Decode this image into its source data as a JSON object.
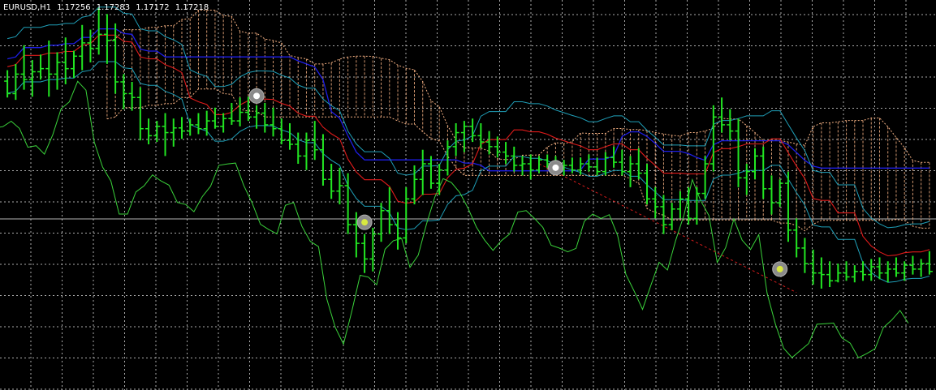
{
  "chart_header": {
    "symbol_timeframe": "EURUSD,H1",
    "open": "1.17256",
    "high": "1.17283",
    "low": "1.17172",
    "close": "1.17218"
  },
  "colors": {
    "background": "#000000",
    "grid": "#c8c8c8",
    "candles": "#22e622",
    "tenkan": "#e21b1b",
    "kijun": "#1e1ee6",
    "upper_band": "#1f9fb8",
    "chikou": "#3ad23a",
    "cloud": "#f5b183",
    "trendline": "#d21b1b",
    "marker": "#8a8a8a"
  },
  "chart_data": {
    "type": "candlestick",
    "symbol": "EURUSD",
    "timeframe": "H1",
    "ylim": [
      1.15,
      1.2
    ],
    "grid": true,
    "candles": [
      [
        1.1896,
        1.191,
        1.1875,
        1.188
      ],
      [
        1.188,
        1.1918,
        1.1872,
        1.1905
      ],
      [
        1.1905,
        1.1942,
        1.1885,
        1.1898
      ],
      [
        1.1898,
        1.1923,
        1.1876,
        1.1908
      ],
      [
        1.1908,
        1.193,
        1.1898,
        1.1912
      ],
      [
        1.1912,
        1.1948,
        1.1876,
        1.1905
      ],
      [
        1.1905,
        1.1933,
        1.1885,
        1.192
      ],
      [
        1.192,
        1.1952,
        1.1892,
        1.1912
      ],
      [
        1.1912,
        1.1935,
        1.19,
        1.1928
      ],
      [
        1.1928,
        1.1968,
        1.191,
        1.1945
      ],
      [
        1.1945,
        1.1962,
        1.192,
        1.1938
      ],
      [
        1.1938,
        1.199,
        1.193,
        1.1956
      ],
      [
        1.1956,
        1.1982,
        1.1918,
        1.1948
      ],
      [
        1.1948,
        1.197,
        1.188,
        1.1895
      ],
      [
        1.1895,
        1.1905,
        1.186,
        1.188
      ],
      [
        1.188,
        1.1895,
        1.1858,
        1.1875
      ],
      [
        1.1875,
        1.1888,
        1.182,
        1.1835
      ],
      [
        1.1835,
        1.1848,
        1.1815,
        1.1826
      ],
      [
        1.1826,
        1.1845,
        1.1818,
        1.1838
      ],
      [
        1.1838,
        1.1855,
        1.18,
        1.183
      ],
      [
        1.183,
        1.1848,
        1.1812,
        1.1836
      ],
      [
        1.1836,
        1.185,
        1.1822,
        1.1832
      ],
      [
        1.1832,
        1.1848,
        1.1826,
        1.184
      ],
      [
        1.184,
        1.1855,
        1.1828,
        1.1835
      ],
      [
        1.1835,
        1.1858,
        1.1826,
        1.1845
      ],
      [
        1.1845,
        1.1862,
        1.1835,
        1.1838
      ],
      [
        1.1838,
        1.1855,
        1.183,
        1.1848
      ],
      [
        1.1848,
        1.1868,
        1.184,
        1.1845
      ],
      [
        1.1845,
        1.1875,
        1.1838,
        1.1856
      ],
      [
        1.1856,
        1.1876,
        1.1845,
        1.185
      ],
      [
        1.185,
        1.1865,
        1.1835,
        1.1855
      ],
      [
        1.1855,
        1.1868,
        1.183,
        1.184
      ],
      [
        1.184,
        1.1862,
        1.1825,
        1.1835
      ],
      [
        1.1835,
        1.1848,
        1.1815,
        1.182
      ],
      [
        1.182,
        1.1842,
        1.1808,
        1.1815
      ],
      [
        1.1815,
        1.183,
        1.179,
        1.18
      ],
      [
        1.18,
        1.183,
        1.1782,
        1.182
      ],
      [
        1.182,
        1.1845,
        1.1795,
        1.1808
      ],
      [
        1.1808,
        1.1828,
        1.1762,
        1.177
      ],
      [
        1.177,
        1.179,
        1.1745,
        1.1755
      ],
      [
        1.1755,
        1.1785,
        1.1738,
        1.1762
      ],
      [
        1.1762,
        1.1778,
        1.17,
        1.1712
      ],
      [
        1.1712,
        1.1728,
        1.167,
        1.1688
      ],
      [
        1.1688,
        1.17,
        1.165,
        1.1668
      ],
      [
        1.1668,
        1.1708,
        1.1652,
        1.17
      ],
      [
        1.17,
        1.174,
        1.169,
        1.173
      ],
      [
        1.173,
        1.176,
        1.17,
        1.1712
      ],
      [
        1.1712,
        1.1728,
        1.168,
        1.1695
      ],
      [
        1.1695,
        1.176,
        1.1688,
        1.1745
      ],
      [
        1.1745,
        1.1788,
        1.1738,
        1.177
      ],
      [
        1.177,
        1.1808,
        1.175,
        1.179
      ],
      [
        1.179,
        1.18,
        1.1758,
        1.1765
      ],
      [
        1.1765,
        1.179,
        1.175,
        1.1782
      ],
      [
        1.1782,
        1.182,
        1.1775,
        1.1812
      ],
      [
        1.1812,
        1.1842,
        1.18,
        1.183
      ],
      [
        1.183,
        1.1845,
        1.1805,
        1.1838
      ],
      [
        1.1838,
        1.1848,
        1.1818,
        1.1826
      ],
      [
        1.1826,
        1.1842,
        1.181,
        1.1818
      ],
      [
        1.1818,
        1.1832,
        1.1802,
        1.1812
      ],
      [
        1.1812,
        1.1825,
        1.1798,
        1.1805
      ],
      [
        1.1805,
        1.1818,
        1.179,
        1.18
      ],
      [
        1.18,
        1.1812,
        1.178,
        1.1788
      ],
      [
        1.1788,
        1.18,
        1.1775,
        1.179
      ],
      [
        1.179,
        1.1802,
        1.177,
        1.1782
      ],
      [
        1.1782,
        1.18,
        1.1778,
        1.1795
      ],
      [
        1.1795,
        1.1802,
        1.1785,
        1.179
      ],
      [
        1.179,
        1.18,
        1.1778,
        1.1785
      ],
      [
        1.1785,
        1.1795,
        1.1775,
        1.1788
      ],
      [
        1.1788,
        1.1798,
        1.1778,
        1.1782
      ],
      [
        1.1782,
        1.1798,
        1.1776,
        1.179
      ],
      [
        1.179,
        1.1802,
        1.178,
        1.1786
      ],
      [
        1.1786,
        1.1798,
        1.1775,
        1.178
      ],
      [
        1.178,
        1.1805,
        1.1775,
        1.1798
      ],
      [
        1.1798,
        1.1812,
        1.1785,
        1.1792
      ],
      [
        1.1792,
        1.1808,
        1.1775,
        1.178
      ],
      [
        1.178,
        1.18,
        1.176,
        1.179
      ],
      [
        1.179,
        1.181,
        1.177,
        1.1778
      ],
      [
        1.1778,
        1.179,
        1.1738,
        1.1745
      ],
      [
        1.1745,
        1.176,
        1.172,
        1.1735
      ],
      [
        1.1735,
        1.175,
        1.17,
        1.1712
      ],
      [
        1.1712,
        1.174,
        1.1705,
        1.1732
      ],
      [
        1.1732,
        1.1755,
        1.172,
        1.1745
      ],
      [
        1.1745,
        1.176,
        1.1712,
        1.172
      ],
      [
        1.172,
        1.176,
        1.1712,
        1.1752
      ],
      [
        1.1752,
        1.18,
        1.1745,
        1.179
      ],
      [
        1.179,
        1.1865,
        1.178,
        1.185
      ],
      [
        1.185,
        1.1875,
        1.183,
        1.184
      ],
      [
        1.184,
        1.186,
        1.182,
        1.1832
      ],
      [
        1.1832,
        1.1848,
        1.176,
        1.1772
      ],
      [
        1.1772,
        1.179,
        1.175,
        1.178
      ],
      [
        1.178,
        1.181,
        1.177,
        1.18
      ],
      [
        1.18,
        1.1812,
        1.1745,
        1.1758
      ],
      [
        1.1758,
        1.1775,
        1.1725,
        1.174
      ],
      [
        1.174,
        1.177,
        1.1735,
        1.1765
      ],
      [
        1.1765,
        1.178,
        1.169,
        1.1705
      ],
      [
        1.1705,
        1.172,
        1.167,
        1.1682
      ],
      [
        1.1682,
        1.1695,
        1.165,
        1.1662
      ],
      [
        1.1662,
        1.168,
        1.1635,
        1.165
      ],
      [
        1.165,
        1.167,
        1.163,
        1.1648
      ],
      [
        1.1648,
        1.1665,
        1.1632,
        1.164
      ],
      [
        1.164,
        1.1662,
        1.1638,
        1.165
      ],
      [
        1.165,
        1.1665,
        1.164,
        1.1645
      ],
      [
        1.1645,
        1.166,
        1.1638,
        1.1652
      ],
      [
        1.1652,
        1.1665,
        1.164,
        1.1648
      ],
      [
        1.1648,
        1.1668,
        1.164,
        1.1658
      ],
      [
        1.1658,
        1.167,
        1.1642,
        1.165
      ],
      [
        1.165,
        1.1665,
        1.1638,
        1.1655
      ],
      [
        1.1655,
        1.167,
        1.1645,
        1.165
      ],
      [
        1.165,
        1.1665,
        1.164,
        1.166
      ],
      [
        1.166,
        1.1672,
        1.1648,
        1.1655
      ],
      [
        1.1655,
        1.1668,
        1.1645,
        1.1662
      ],
      [
        1.1662,
        1.1678,
        1.1648,
        1.1652
      ]
    ],
    "indicators": {
      "kijun": [
        1.1878,
        1.1878,
        1.1878,
        1.1878,
        1.1878,
        1.1878,
        1.1878,
        1.1878,
        1.1878,
        1.1878,
        1.1878,
        1.1878,
        1.1878,
        1.1878,
        1.1878,
        1.1878,
        1.1878,
        1.1878,
        1.1878,
        1.1878,
        1.1878,
        1.1878,
        1.1878,
        1.1878,
        1.1878,
        1.1878,
        1.1878,
        1.1878,
        1.1878,
        1.1878,
        1.1878,
        1.1878,
        1.1878,
        1.1878,
        1.1878,
        1.1878,
        1.1878,
        1.1878,
        1.1878,
        1.1878,
        1.1878,
        1.1878,
        1.1878,
        1.1878,
        1.1878,
        1.1878,
        1.1878,
        1.1878,
        1.1878,
        1.1878,
        1.1878,
        1.1878,
        1.1878,
        1.1878,
        1.1878,
        1.1878,
        1.1878,
        1.1878,
        1.1878,
        1.1878,
        1.1878,
        1.1878,
        1.1878,
        1.1878,
        1.1878,
        1.1878,
        1.1878,
        1.1878,
        1.1878,
        1.1878,
        1.1878,
        1.1878,
        1.1878,
        1.1878,
        1.1878,
        1.1878,
        1.1878,
        1.1878,
        1.1878,
        1.1878,
        1.1878,
        1.1878,
        1.1878,
        1.1878,
        1.1878,
        1.1878,
        1.1878,
        1.1878,
        1.1878,
        1.1878,
        1.1878,
        1.1878,
        1.1878,
        1.1878,
        1.1878,
        1.1878,
        1.1878,
        1.1878,
        1.1878,
        1.1878,
        1.1878,
        1.1878,
        1.1878,
        1.1878,
        1.1878,
        1.1878,
        1.1878,
        1.1878,
        1.1878,
        1.1878,
        1.1878,
        1.1878
      ]
    },
    "trend_markers": [
      {
        "index": 30,
        "price": 1.1877,
        "kind": "sell"
      },
      {
        "index": 43,
        "price": 1.1715,
        "kind": "buy"
      },
      {
        "index": 66,
        "price": 1.1785,
        "kind": "sell"
      },
      {
        "index": 93,
        "price": 1.1655,
        "kind": "buy"
      }
    ]
  }
}
